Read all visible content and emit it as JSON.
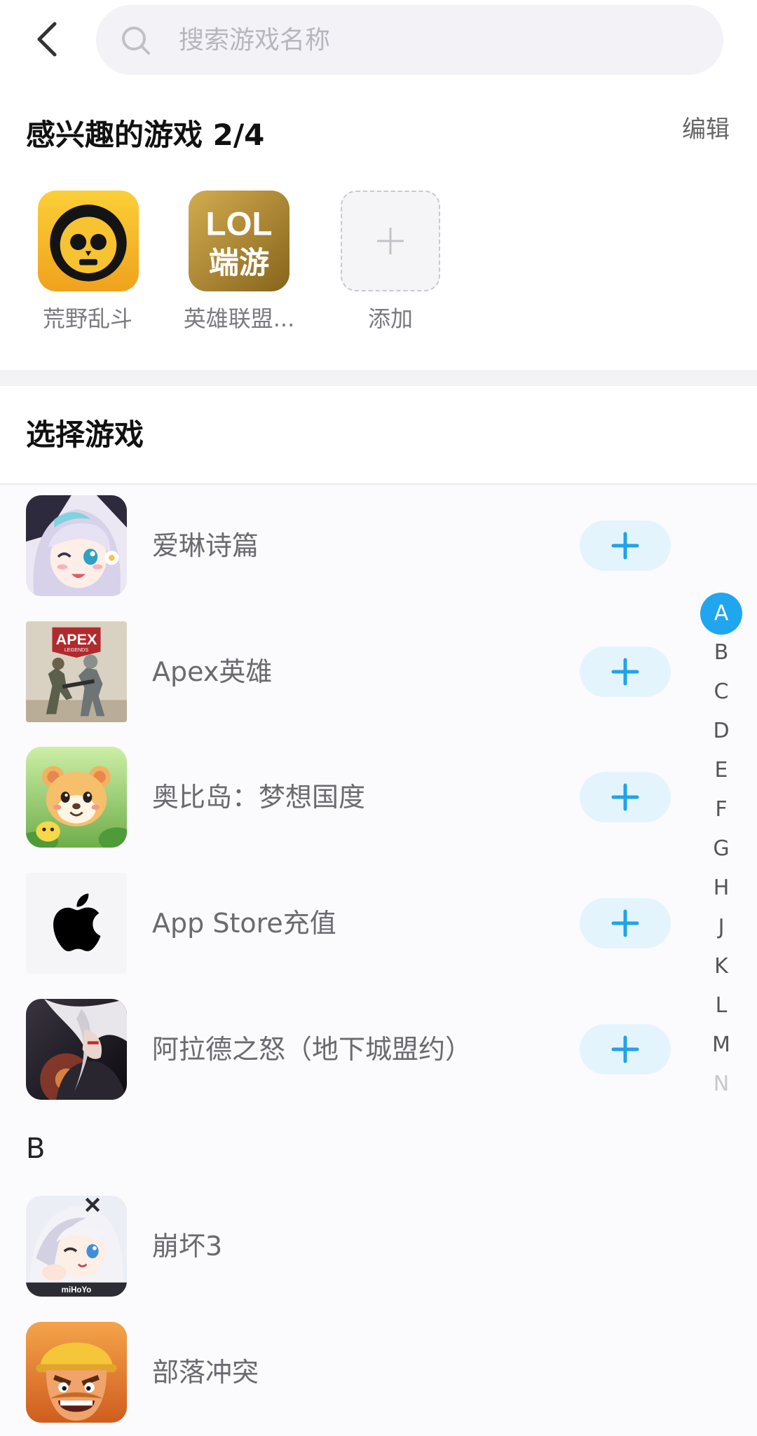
{
  "header": {
    "back_icon": "chevron-left-icon",
    "search_icon": "search-icon",
    "search_placeholder": "搜索游戏名称"
  },
  "interested": {
    "title": "感兴趣的游戏 2/4",
    "edit_label": "编辑",
    "games": [
      {
        "name": "荒野乱斗",
        "icon": "brawl-stars-icon"
      },
      {
        "name": "英雄联盟...",
        "icon": "lol-icon",
        "logo_text": [
          "LOL",
          "端游"
        ]
      }
    ],
    "add_label": "添加",
    "add_icon": "plus-icon"
  },
  "select": {
    "title": "选择游戏",
    "sections": [
      {
        "games": [
          {
            "name": "爱琳诗篇",
            "icon": "eileen-poem-icon"
          },
          {
            "name": "Apex英雄",
            "icon": "apex-legends-icon",
            "logo_text": [
              "APEX",
              "LEGENDS"
            ]
          },
          {
            "name": "奥比岛：梦想国度",
            "icon": "aobi-island-icon"
          },
          {
            "name": "App Store充值",
            "icon": "apple-icon"
          },
          {
            "name": "阿拉德之怒（地下城盟约）",
            "icon": "arad-rage-icon"
          }
        ]
      },
      {
        "header": "B",
        "games": [
          {
            "name": "崩坏3",
            "icon": "honkai-impact-3-icon",
            "logo_text": [
              "miHoYo"
            ]
          },
          {
            "name": "部落冲突",
            "icon": "clash-of-clans-icon"
          }
        ]
      }
    ]
  },
  "index": {
    "letters": [
      "A",
      "B",
      "C",
      "D",
      "E",
      "F",
      "G",
      "H",
      "J",
      "K",
      "L",
      "M",
      "N"
    ],
    "active": "A"
  },
  "colors": {
    "accent": "#1fa6ef",
    "add_button_bg": "#e4f4fd",
    "search_bg": "#f3f3f7",
    "text_primary": "#111111",
    "text_secondary": "#6a6a70"
  }
}
